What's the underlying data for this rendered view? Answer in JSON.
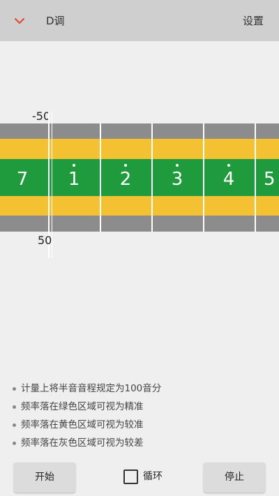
{
  "header": {
    "back_icon": "chevron-down-icon",
    "title": "D调",
    "settings_label": "设置"
  },
  "tuner": {
    "top_label": "-50",
    "bottom_label": "50",
    "notes": [
      {
        "digit": "7",
        "dot_above": false
      },
      {
        "digit": "1",
        "dot_above": true
      },
      {
        "digit": "2",
        "dot_above": true
      },
      {
        "digit": "3",
        "dot_above": true
      },
      {
        "digit": "4",
        "dot_above": true
      },
      {
        "digit": "5",
        "dot_above": false
      }
    ],
    "colors": {
      "gray": "#8c8c8c",
      "yellow": "#f4c132",
      "green": "#1f9b3e"
    }
  },
  "tips": [
    "计量上将半音音程规定为100音分",
    "频率落在绿色区域可视为精准",
    "频率落在黄色区域可视为较准",
    "频率落在灰色区域可视为较差"
  ],
  "controls": {
    "start_label": "开始",
    "loop_label": "循环",
    "loop_checked": false,
    "stop_label": "停止"
  }
}
